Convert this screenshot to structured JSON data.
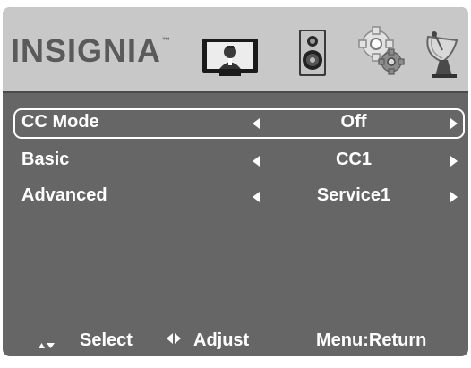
{
  "brand": {
    "name": "INSIGNIA",
    "trademark": "™",
    "color": "#5a5a5a"
  },
  "tabs": [
    {
      "icon": "tv-picture-icon"
    },
    {
      "icon": "speaker-icon"
    },
    {
      "icon": "gears-settings-icon"
    },
    {
      "icon": "satellite-dish-icon"
    }
  ],
  "menu": {
    "items": [
      {
        "label": "CC Mode",
        "value": "Off",
        "selected": true
      },
      {
        "label": "Basic",
        "value": "CC1",
        "selected": false
      },
      {
        "label": "Advanced",
        "value": "Service1",
        "selected": false
      }
    ]
  },
  "footer": {
    "select_label": "Select",
    "adjust_label": "Adjust",
    "return_label": "Menu:Return"
  },
  "colors": {
    "menu_background": "#666666",
    "header_background": "#c8c8c8",
    "text": "#ffffff",
    "selection_border": "#ffffff"
  }
}
